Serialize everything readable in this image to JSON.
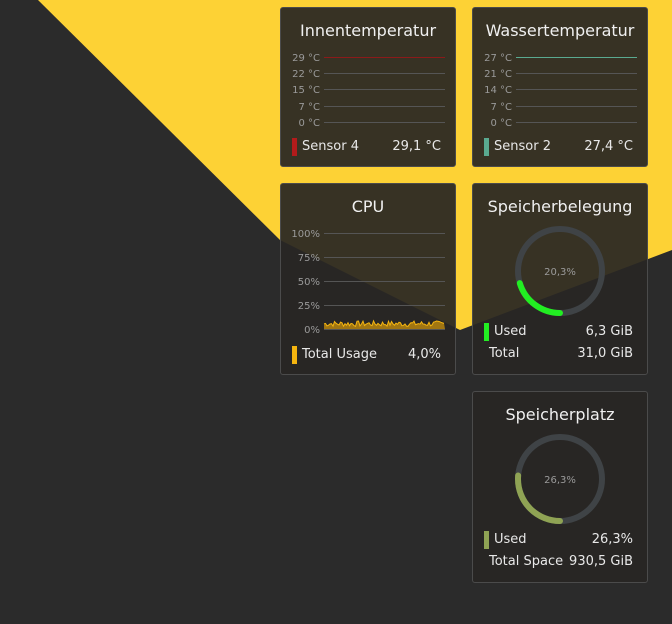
{
  "colors": {
    "wallpaper_yellow": "#fdd235",
    "wallpaper_dark": "#2b2b2b",
    "sensor4": "#b31b1b",
    "sensor2": "#5aaa90",
    "cpu": "#f5b50f",
    "ram_used": "#22ee22",
    "disk_used": "#8fa354",
    "gauge_track": "#3f4346"
  },
  "widgets": {
    "inside_temp": {
      "title": "Innentemperatur",
      "axis": [
        "29 °C",
        "22 °C",
        "15 °C",
        "7 °C",
        "0 °C"
      ],
      "sensor": {
        "name": "Sensor 4",
        "value": "29,1 °C",
        "reading": 29.1,
        "max": 29
      }
    },
    "water_temp": {
      "title": "Wassertemperatur",
      "axis": [
        "27 °C",
        "21 °C",
        "14 °C",
        "7 °C",
        "0 °C"
      ],
      "sensor": {
        "name": "Sensor 2",
        "value": "27,4 °C",
        "reading": 27.4,
        "max": 27
      }
    },
    "cpu": {
      "title": "CPU",
      "axis": [
        "100%",
        "75%",
        "50%",
        "25%",
        "0%"
      ],
      "legend": {
        "name": "Total Usage",
        "value": "4,0%"
      }
    },
    "ram": {
      "title": "Speicherbelegung",
      "percent_label": "20,3%",
      "fraction": 0.203,
      "used": {
        "name": "Used",
        "value": "6,3 GiB"
      },
      "total": {
        "name": "Total",
        "value": "31,0 GiB"
      }
    },
    "disk": {
      "title": "Speicherplatz",
      "percent_label": "26,3%",
      "fraction": 0.263,
      "used": {
        "name": "Used",
        "value": "26,3%"
      },
      "total": {
        "name": "Total Space",
        "value": "930,5 GiB"
      }
    }
  }
}
